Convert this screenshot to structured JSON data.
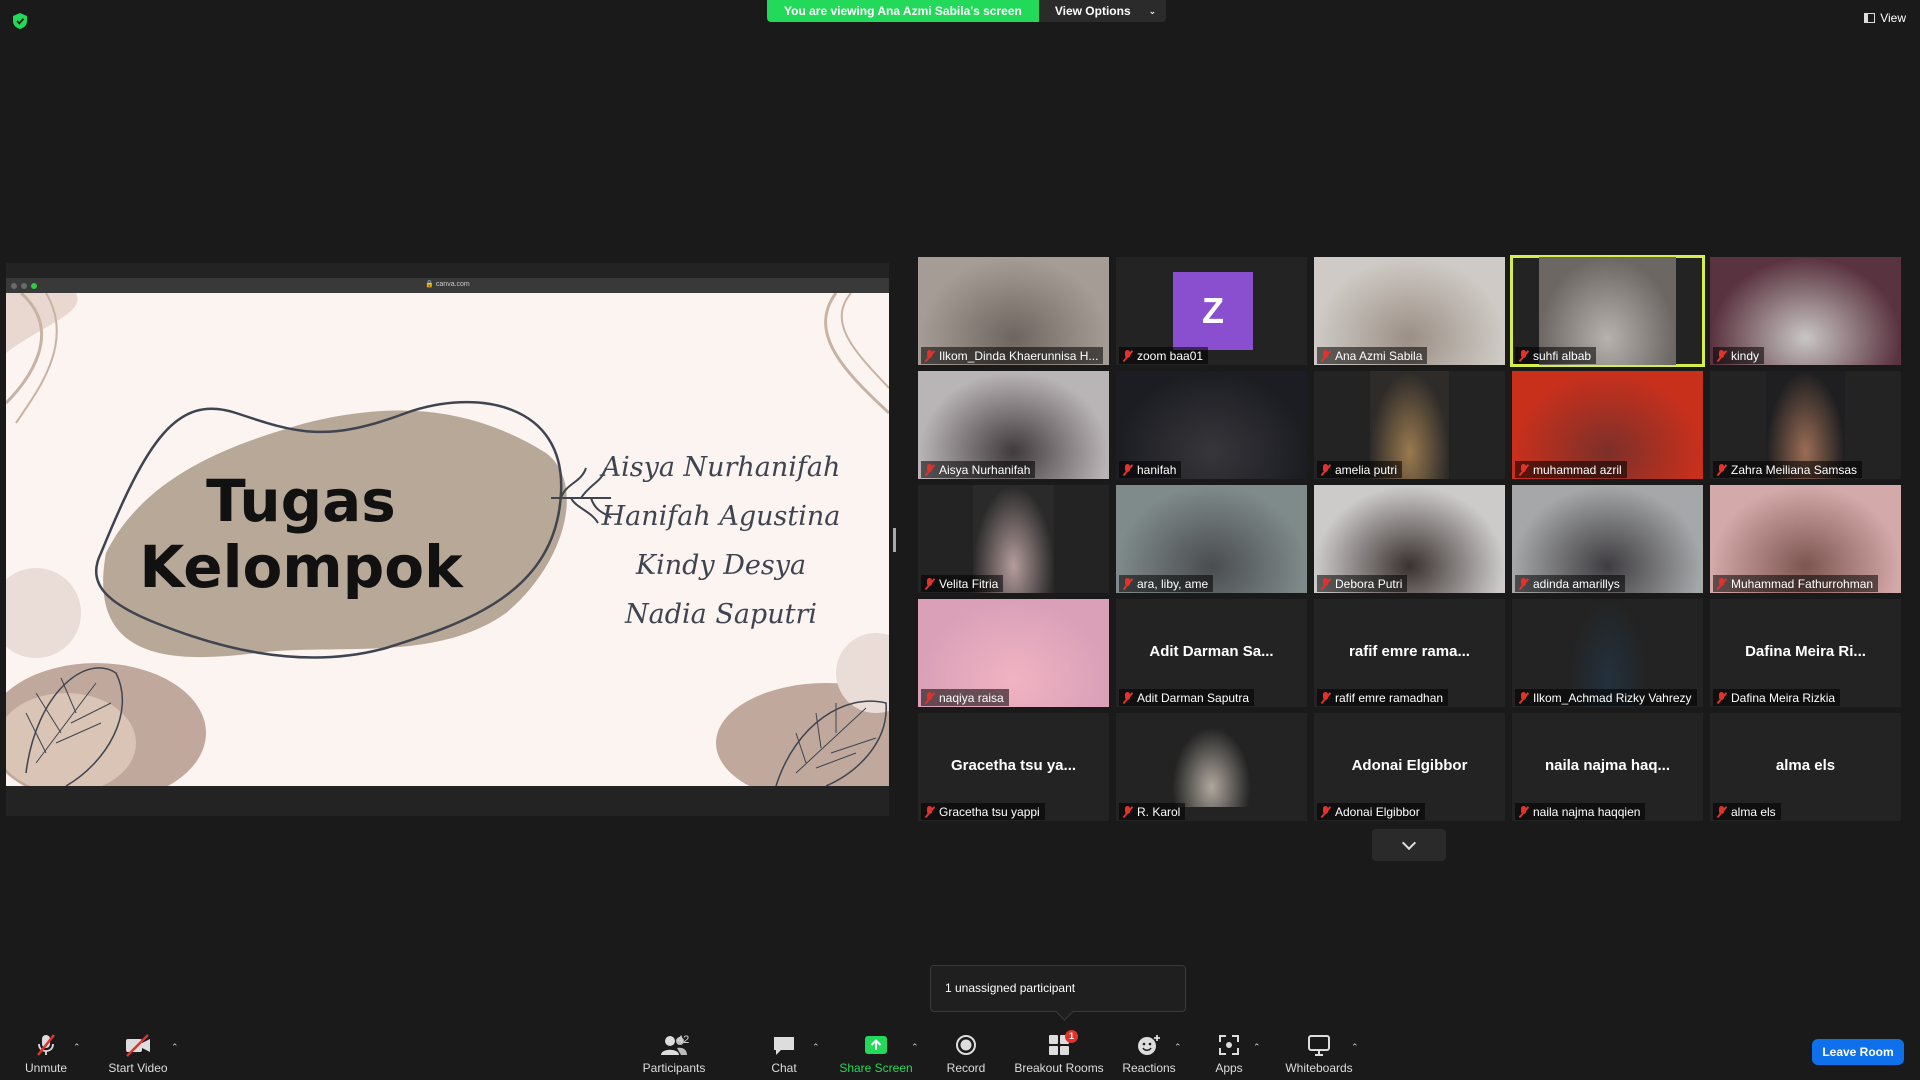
{
  "banner": {
    "viewing_text": "You are viewing Ana Azmi Sabila's screen",
    "view_options_label": "View Options",
    "view_label": "View"
  },
  "shared_screen": {
    "url": "canva.com",
    "slide_title_line1": "Tugas",
    "slide_title_line2": "Kelompok",
    "members": [
      "Aisya Nurhanifah",
      "Hanifah Agustina",
      "Kindy Desya",
      "Nadia Saputri"
    ]
  },
  "participants": [
    {
      "name": "Ilkom_Dinda Khaerunnisa H...",
      "muted": true,
      "video": "camera"
    },
    {
      "name": "zoom baa01",
      "muted": true,
      "video": "avatar",
      "avatar_letter": "Z"
    },
    {
      "name": "Ana Azmi Sabila",
      "muted": true,
      "video": "camera"
    },
    {
      "name": "suhfi albab",
      "muted": true,
      "video": "camera",
      "active_speaker": true
    },
    {
      "name": "kindy",
      "muted": true,
      "video": "camera"
    },
    {
      "name": "Aisya Nurhanifah",
      "muted": true,
      "video": "camera"
    },
    {
      "name": "hanifah",
      "muted": true,
      "video": "camera"
    },
    {
      "name": "amelia putri",
      "muted": true,
      "video": "camera"
    },
    {
      "name": "muhammad azril",
      "muted": true,
      "video": "camera"
    },
    {
      "name": "Zahra Meiliana Samsas",
      "muted": true,
      "video": "camera"
    },
    {
      "name": "Velita Fitria",
      "muted": true,
      "video": "camera"
    },
    {
      "name": "ara, liby, ame",
      "muted": true,
      "video": "camera"
    },
    {
      "name": "Debora Putri",
      "muted": true,
      "video": "camera"
    },
    {
      "name": "adinda amarillys",
      "muted": true,
      "video": "camera"
    },
    {
      "name": "Muhammad Fathurrohman",
      "muted": true,
      "video": "camera"
    },
    {
      "name": "naqiya raisa",
      "muted": true,
      "video": "camera"
    },
    {
      "name": "Adit Darman Saputra",
      "muted": true,
      "video": "off",
      "display_name": "Adit Darman Sa..."
    },
    {
      "name": "rafif emre ramadhan",
      "muted": true,
      "video": "off",
      "display_name": "rafif emre rama..."
    },
    {
      "name": "Ilkom_Achmad Rizky Vahrezy",
      "muted": true,
      "video": "camera"
    },
    {
      "name": "Dafina Meira Rizkia",
      "muted": true,
      "video": "off",
      "display_name": "Dafina Meira Ri..."
    },
    {
      "name": "Gracetha tsu yappi",
      "muted": true,
      "video": "off",
      "display_name": "Gracetha tsu ya..."
    },
    {
      "name": "R. Karol",
      "muted": true,
      "video": "camera"
    },
    {
      "name": "Adonai Elgibbor",
      "muted": true,
      "video": "off",
      "display_name": "Adonai Elgibbor"
    },
    {
      "name": "naila najma haqqien",
      "muted": true,
      "video": "off",
      "display_name": "naila najma haq..."
    },
    {
      "name": "alma els",
      "muted": true,
      "video": "off",
      "display_name": "alma els"
    }
  ],
  "tooltip": {
    "text": "1 unassigned participant"
  },
  "toolbar": {
    "unmute": "Unmute",
    "start_video": "Start Video",
    "participants": "Participants",
    "participants_count": "42",
    "chat": "Chat",
    "share_screen": "Share Screen",
    "record": "Record",
    "breakout_rooms": "Breakout Rooms",
    "breakout_badge": "1",
    "reactions": "Reactions",
    "apps": "Apps",
    "whiteboards": "Whiteboards",
    "leave_room": "Leave Room"
  },
  "colors": {
    "share_green": "#23d959",
    "active_speaker": "#d6ee4c",
    "leave_blue": "#0e71eb",
    "muted_red": "#e0332b",
    "avatar_purple": "#8a4fcf"
  }
}
